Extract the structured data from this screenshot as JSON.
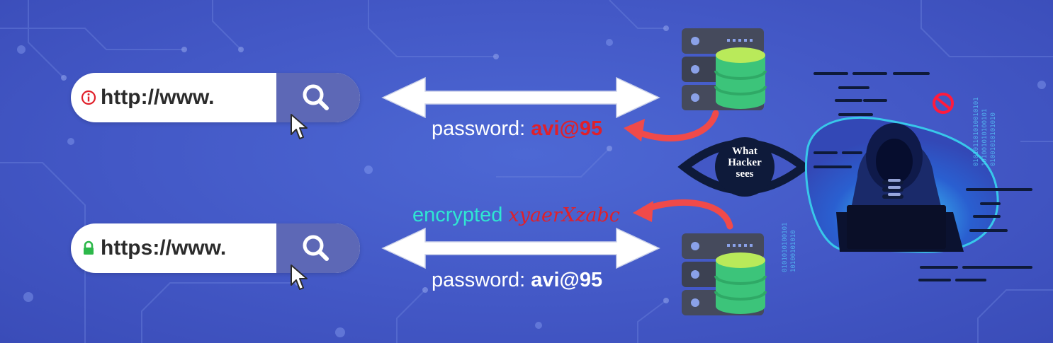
{
  "insecure": {
    "url_text": "http://www.",
    "status_icon": "info-icon",
    "status_color": "#e0202a",
    "password_label": "password:",
    "password_value": "avi@95"
  },
  "secure": {
    "url_text": "https://www.",
    "status_icon": "lock-icon",
    "status_color": "#2db84a",
    "password_label": "password:",
    "password_value": "avi@95",
    "encrypted_label": "encrypted",
    "encrypted_value": "xyaerXzabc"
  },
  "eye": {
    "line1": "What",
    "line2": "Hacker",
    "line3": "sees"
  },
  "colors": {
    "background": "#4358c6",
    "search_button": "#5d68b6",
    "arrow_red": "#f04a4a",
    "encrypted_text": "#2fe6d2",
    "server_body": "#454a5c",
    "database_green": "#3cc47a",
    "hacker_outline": "#38c8ea"
  },
  "icons": [
    "search-icon",
    "cursor-icon",
    "server-icon",
    "database-icon",
    "eye-icon",
    "hacker-icon",
    "no-entry-icon"
  ]
}
